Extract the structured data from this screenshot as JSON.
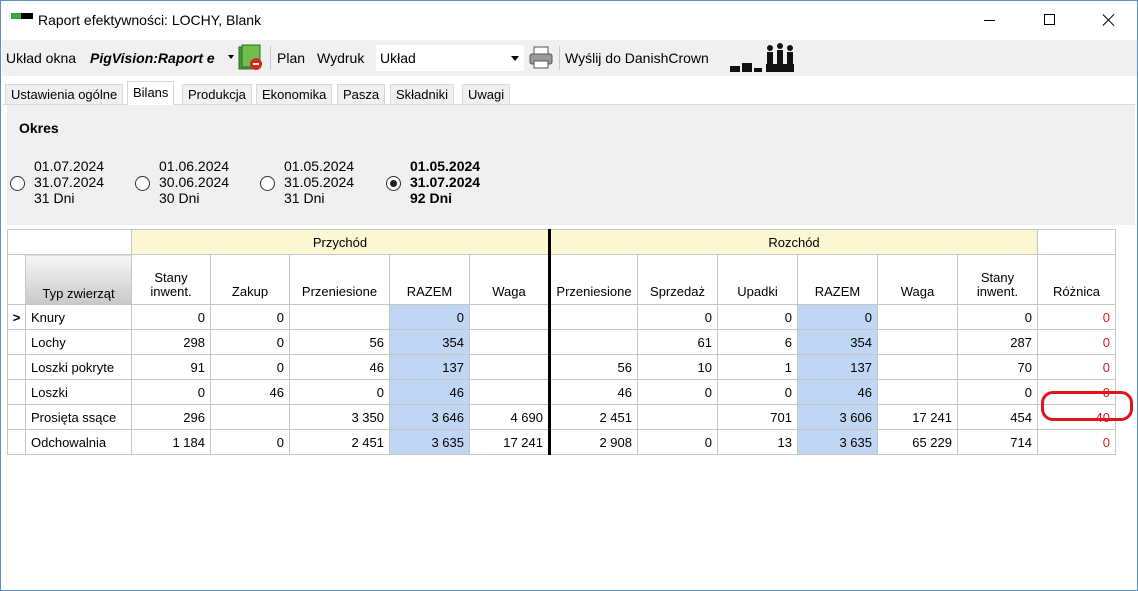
{
  "window": {
    "title": "Raport efektywności: LOCHY, Blank"
  },
  "toolbar": {
    "layout_label": "Układ okna",
    "layout_value": "PigVision:Raport e",
    "plan": "Plan",
    "print": "Wydruk",
    "layout2_label": "Układ",
    "send": "Wyślij do DanishCrown"
  },
  "tabs": [
    "Ustawienia ogólne",
    "Bilans",
    "Produkcja",
    "Ekonomika",
    "Pasza",
    "Składniki",
    "Uwagi"
  ],
  "okres": {
    "label": "Okres",
    "options": [
      {
        "from": "01.07.2024",
        "to": "31.07.2024",
        "days": "31 Dni"
      },
      {
        "from": "01.06.2024",
        "to": "30.06.2024",
        "days": "30 Dni"
      },
      {
        "from": "01.05.2024",
        "to": "31.05.2024",
        "days": "31 Dni"
      },
      {
        "from": "01.05.2024",
        "to": "31.07.2024",
        "days": "92 Dni"
      }
    ]
  },
  "grid": {
    "group_income": "Przychód",
    "group_outcome": "Rozchód",
    "typ_head": "Typ zwierząt",
    "selector": ">",
    "income_cols": [
      "Stany\ninwent.",
      "Zakup",
      "Przeniesione",
      "RAZEM",
      "Waga"
    ],
    "outcome_cols": [
      "Przeniesione",
      "Sprzedaż",
      "Upadki",
      "RAZEM",
      "Waga",
      "Stany\ninwent."
    ],
    "diff_col": "Różnica",
    "rows": [
      {
        "type": "Knury",
        "inc": [
          "0",
          "0",
          "",
          "0",
          ""
        ],
        "out": [
          "",
          "0",
          "0",
          "0",
          "",
          "0"
        ],
        "diff": "0"
      },
      {
        "type": "Lochy",
        "inc": [
          "298",
          "0",
          "56",
          "354",
          ""
        ],
        "out": [
          "",
          "61",
          "6",
          "354",
          "",
          "287"
        ],
        "diff": "0"
      },
      {
        "type": "Loszki pokryte",
        "inc": [
          "91",
          "0",
          "46",
          "137",
          ""
        ],
        "out": [
          "56",
          "10",
          "1",
          "137",
          "",
          "70"
        ],
        "diff": "0"
      },
      {
        "type": "Loszki",
        "inc": [
          "0",
          "46",
          "0",
          "46",
          ""
        ],
        "out": [
          "46",
          "0",
          "0",
          "46",
          "",
          "0"
        ],
        "diff": "0"
      },
      {
        "type": "Prosięta ssące",
        "inc": [
          "296",
          "",
          "3 350",
          "3 646",
          "4 690"
        ],
        "out": [
          "2 451",
          "",
          "701",
          "3 606",
          "17 241",
          "454"
        ],
        "diff": "40"
      },
      {
        "type": "Odchowalnia",
        "inc": [
          "1 184",
          "0",
          "2 451",
          "3 635",
          "17 241"
        ],
        "out": [
          "2 908",
          "0",
          "13",
          "3 635",
          "65 229",
          "714"
        ],
        "diff": "0"
      }
    ]
  }
}
